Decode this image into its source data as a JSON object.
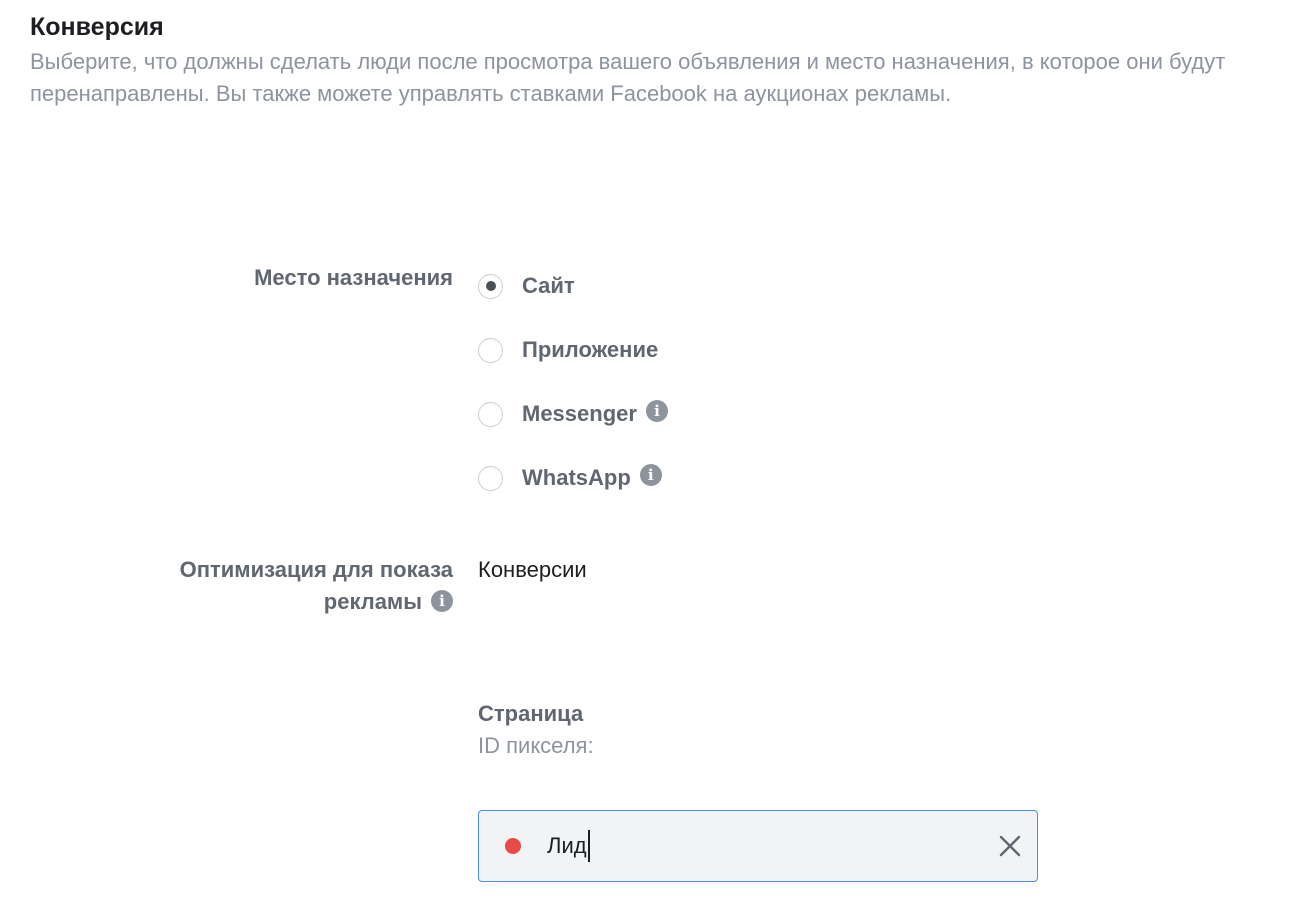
{
  "section": {
    "title": "Конверсия",
    "description": "Выберите, что должны сделать люди после просмотра вашего объявления и место назначения, в которое они будут перенаправлены. Вы также можете управлять ставками Facebook на аукционах рекламы."
  },
  "destination": {
    "label": "Место назначения",
    "options": [
      {
        "label": "Сайт",
        "selected": true,
        "info": false
      },
      {
        "label": "Приложение",
        "selected": false,
        "info": false
      },
      {
        "label": "Messenger",
        "selected": false,
        "info": true
      },
      {
        "label": "WhatsApp",
        "selected": false,
        "info": true
      }
    ]
  },
  "optimization": {
    "label_line1": "Оптимизация для показа",
    "label_line2": "рекламы",
    "value": "Конверсии"
  },
  "pixel": {
    "page_label": "Страница",
    "pixel_id_label": "ID пикселя:"
  },
  "event_input": {
    "value": "Лид",
    "status_color": "#e8494a"
  },
  "icons": {
    "info_glyph": "i"
  }
}
